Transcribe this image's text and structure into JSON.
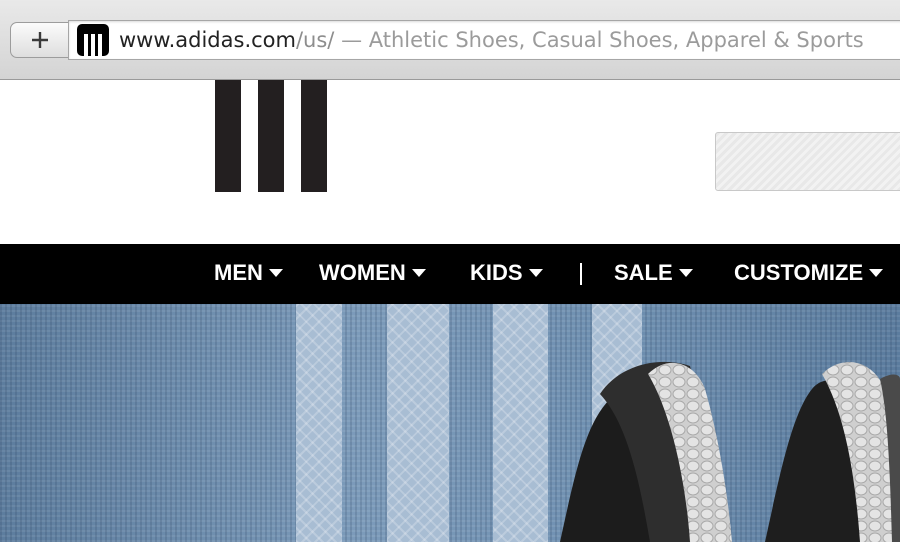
{
  "browser": {
    "new_tab_icon": "plus-icon",
    "favicon": "adidas-logo-icon",
    "url_domain": "www.adidas.com",
    "url_path": "/us/",
    "page_title": " — Athletic Shoes, Casual Shoes, Apparel & Sports"
  },
  "header": {
    "logo": "adidas-three-stripes-logo",
    "search_placeholder": ""
  },
  "nav": {
    "items": [
      {
        "label": "MEN"
      },
      {
        "label": "WOMEN"
      },
      {
        "label": "KIDS"
      },
      {
        "label": "SALE"
      },
      {
        "label": "CUSTOMIZE"
      }
    ]
  },
  "hero": {
    "image": "sneakers-on-blue-mesh-banner"
  },
  "colors": {
    "nav_background": "#000000",
    "logo": "#231f20",
    "hero_blue": "#6f8eae"
  }
}
